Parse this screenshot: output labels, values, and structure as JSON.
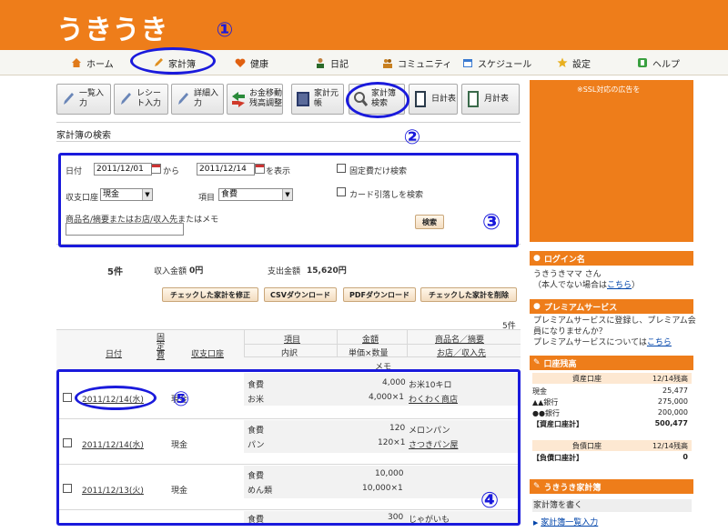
{
  "header": {
    "logo": "うきうき"
  },
  "nav": [
    {
      "label": "ホーム",
      "icon": "home-icon",
      "color": "#e07a1a"
    },
    {
      "label": "家計簿",
      "icon": "pencil-icon",
      "color": "#e09020"
    },
    {
      "label": "健康",
      "icon": "heart-icon",
      "color": "#e06010"
    },
    {
      "label": "日記",
      "icon": "person-icon",
      "color": "#2a6a2a"
    },
    {
      "label": "コミュニティ",
      "icon": "people-icon",
      "color": "#c88020"
    },
    {
      "label": "スケジュール",
      "icon": "calendar-icon",
      "color": "#3a7ad0"
    },
    {
      "label": "設定",
      "icon": "star-icon",
      "color": "#e8b020"
    },
    {
      "label": "ヘルプ",
      "icon": "help-icon",
      "color": "#3aa040"
    }
  ],
  "toolbar": [
    {
      "label": "一覧入力",
      "icon": "pen-icon"
    },
    {
      "label": "レシート入力",
      "icon": "receipt-icon"
    },
    {
      "label": "詳細入力",
      "icon": "pen-icon"
    },
    {
      "label": "お金移動\n残高調整",
      "icon": "transfer-icon"
    },
    {
      "label": "家計元帳",
      "icon": "ledger-icon"
    },
    {
      "label": "家計簿\n検索",
      "icon": "magnifier-icon"
    },
    {
      "label": "日計表",
      "icon": "daily-icon"
    },
    {
      "label": "月計表",
      "icon": "monthly-icon"
    }
  ],
  "search": {
    "title": "家計簿の検索",
    "date_label": "日付",
    "date_from": "2011/12/01",
    "from_label": "から",
    "date_to": "2011/12/14",
    "to_label": "を表示",
    "fixed_only": "固定費だけ検索",
    "card_only": "カード引落しを検索",
    "account_label": "収支口座",
    "account_value": "現金",
    "item_label": "項目",
    "item_value": "食費",
    "keyword_label": "商品名/摘要またはお店/収入先またはメモ",
    "keyword_value": "",
    "search_button": "検索"
  },
  "summary": {
    "count": "5件",
    "income_label": "収入金額",
    "income_value": "0円",
    "expense_label": "支出金額",
    "expense_value": "15,620円",
    "count_right": "5件"
  },
  "actions": [
    "チェックした家計を修正",
    "CSVダウンロード",
    "PDFダウンロード",
    "チェックした家計を削除"
  ],
  "table": {
    "h_date": "日付",
    "h_fixed": "固定費",
    "h_account": "収支口座",
    "h_item": "項目",
    "h_amount": "金額",
    "h_product": "商品名／摘要",
    "h_detail": "内訳",
    "h_unit": "単価×数量",
    "h_shop": "お店／収入先",
    "h_memo": "メモ",
    "rows": [
      {
        "date": "2011/12/14(水)",
        "account": "現金",
        "item": "食費",
        "amount": "4,000",
        "product": "お米10キロ",
        "detail": "お米",
        "unit": "4,000×1",
        "shop": "わくわく商店"
      },
      {
        "date": "2011/12/14(水)",
        "account": "現金",
        "item": "食費",
        "amount": "120",
        "product": "メロンパン",
        "detail": "パン",
        "unit": "120×1",
        "shop": "さつきパン屋"
      },
      {
        "date": "2011/12/13(火)",
        "account": "現金",
        "item": "食費",
        "amount": "10,000",
        "product": "",
        "detail": "めん類",
        "unit": "10,000×1",
        "shop": ""
      },
      {
        "date": "",
        "account": "",
        "item": "食費",
        "amount": "300",
        "product": "じゃがいも",
        "detail": "",
        "unit": "",
        "shop": ""
      }
    ]
  },
  "sidebar": {
    "ad": "※SSL対応の広告を",
    "login_head": "ログイン名",
    "login_name": "うきうきママ さん",
    "login_not_you": "（本人でない場合は",
    "login_link": "こちら",
    "login_close": "）",
    "premium_head": "プレミアムサービス",
    "premium_text1": "プレミアムサービスに登録し、プレミアム会",
    "premium_text2": "員になりませんか？",
    "premium_text3": "プレミアムサービスについては",
    "premium_link": "こちら",
    "balance_head": "口座残高",
    "asset_label": "資産口座",
    "asset_date": "12/14残高",
    "assets": [
      {
        "name": "現金",
        "value": "25,477"
      },
      {
        "name": "▲▲銀行",
        "value": "275,000"
      },
      {
        "name": "●●銀行",
        "value": "200,000"
      },
      {
        "name": "【資産口座計】",
        "value": "500,477"
      }
    ],
    "debt_label": "負債口座",
    "debt_date": "12/14残高",
    "debts": [
      {
        "name": "【負債口座計】",
        "value": "0"
      }
    ],
    "kakeibo_head": "うきうき家計簿",
    "kakeibo_write": "家計簿を書く",
    "kakeibo_link": "家計簿一覧入力"
  },
  "annotations": [
    "①",
    "②",
    "③",
    "④",
    "⑤"
  ]
}
